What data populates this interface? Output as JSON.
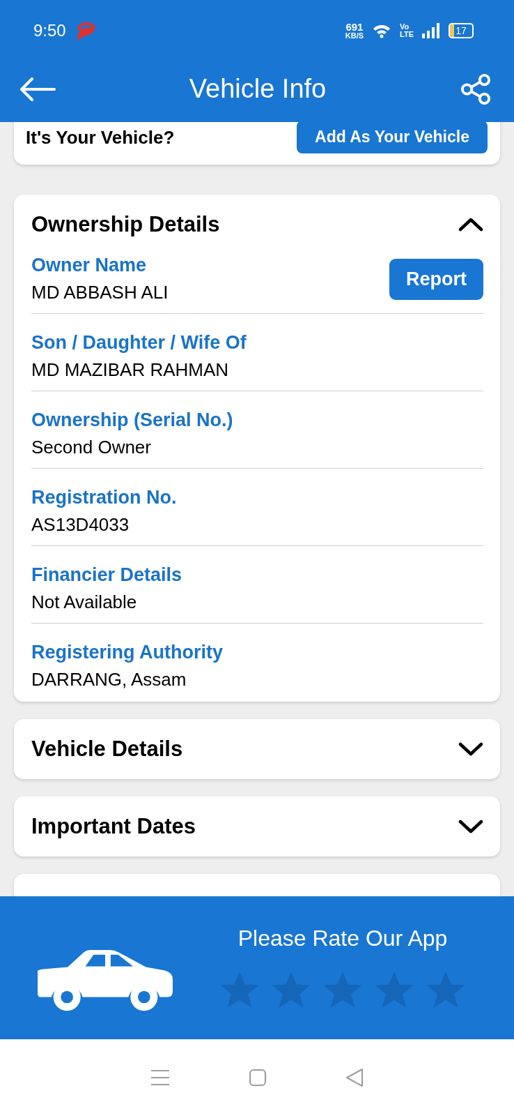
{
  "status_bar": {
    "time": "9:50",
    "speed": "691",
    "speed_unit": "KB/S",
    "volte_top": "Vo",
    "volte_bottom": "LTE",
    "battery": "17"
  },
  "header": {
    "title": "Vehicle Info"
  },
  "claim_card": {
    "question": "It's Your Vehicle?",
    "button": "Add As Your Vehicle"
  },
  "sections": [
    {
      "title": "Ownership Details",
      "expanded": true,
      "fields": [
        {
          "label": "Owner Name",
          "value": "MD ABBASH ALI",
          "action": "Report"
        },
        {
          "label": "Son / Daughter / Wife Of",
          "value": "MD MAZIBAR RAHMAN"
        },
        {
          "label": "Ownership (Serial No.)",
          "value": "Second Owner"
        },
        {
          "label": "Registration No.",
          "value": "AS13D4033"
        },
        {
          "label": "Financier Details",
          "value": "Not Available"
        },
        {
          "label": "Registering Authority",
          "value": "DARRANG, Assam"
        }
      ]
    },
    {
      "title": "Vehicle Details",
      "expanded": false
    },
    {
      "title": "Important Dates",
      "expanded": false
    }
  ],
  "rating_banner": {
    "title": "Please Rate Our App"
  }
}
